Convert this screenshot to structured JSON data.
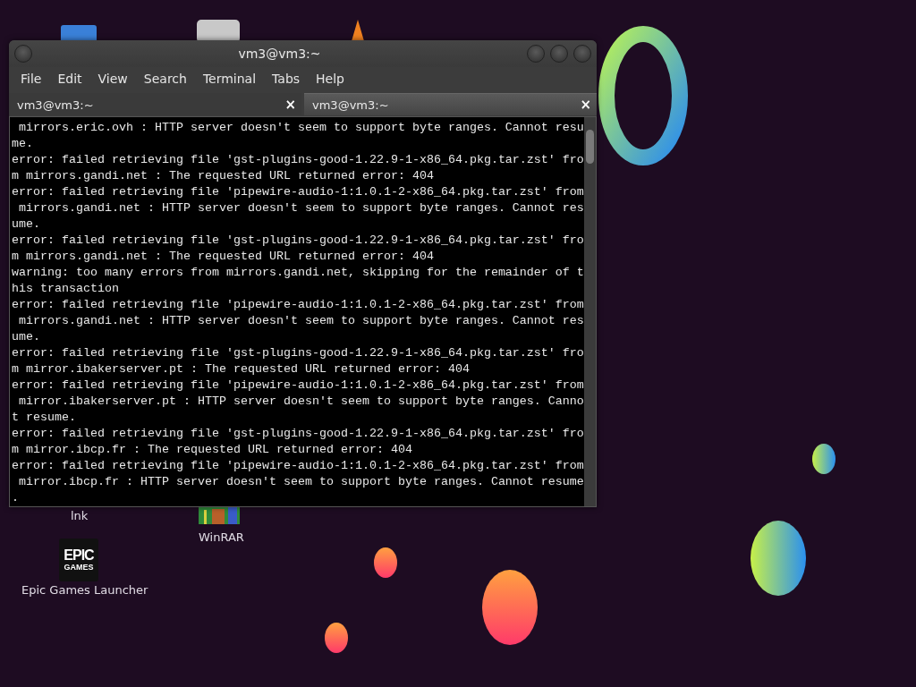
{
  "desktop": {
    "icons": [
      {
        "label": "lnk",
        "kind": "label"
      },
      {
        "label": "WinRAR",
        "kind": "winrar"
      },
      {
        "label": "Epic Games Launcher",
        "kind": "epic",
        "logo_top": "EPIC",
        "logo_bottom": "GAMES"
      }
    ]
  },
  "window": {
    "title": "vm3@vm3:~",
    "menu": [
      "File",
      "Edit",
      "View",
      "Search",
      "Terminal",
      "Tabs",
      "Help"
    ],
    "tabs": [
      {
        "label": "vm3@vm3:~",
        "selected": false
      },
      {
        "label": "vm3@vm3:~",
        "selected": true
      }
    ],
    "close_glyph": "×",
    "lines": [
      " mirrors.eric.ovh : HTTP server doesn't seem to support byte ranges. Cannot resu",
      "me.",
      "error: failed retrieving file 'gst-plugins-good-1.22.9-1-x86_64.pkg.tar.zst' fro",
      "m mirrors.gandi.net : The requested URL returned error: 404",
      "error: failed retrieving file 'pipewire-audio-1:1.0.1-2-x86_64.pkg.tar.zst' from",
      " mirrors.gandi.net : HTTP server doesn't seem to support byte ranges. Cannot res",
      "ume.",
      "error: failed retrieving file 'gst-plugins-good-1.22.9-1-x86_64.pkg.tar.zst' fro",
      "m mirrors.gandi.net : The requested URL returned error: 404",
      "warning: too many errors from mirrors.gandi.net, skipping for the remainder of t",
      "his transaction",
      "error: failed retrieving file 'pipewire-audio-1:1.0.1-2-x86_64.pkg.tar.zst' from",
      " mirrors.gandi.net : HTTP server doesn't seem to support byte ranges. Cannot res",
      "ume.",
      "error: failed retrieving file 'gst-plugins-good-1.22.9-1-x86_64.pkg.tar.zst' fro",
      "m mirror.ibakerserver.pt : The requested URL returned error: 404",
      "error: failed retrieving file 'pipewire-audio-1:1.0.1-2-x86_64.pkg.tar.zst' from",
      " mirror.ibakerserver.pt : HTTP server doesn't seem to support byte ranges. Canno",
      "t resume.",
      "error: failed retrieving file 'gst-plugins-good-1.22.9-1-x86_64.pkg.tar.zst' fro",
      "m mirror.ibcp.fr : The requested URL returned error: 404",
      "error: failed retrieving file 'pipewire-audio-1:1.0.1-2-x86_64.pkg.tar.zst' from",
      " mirror.ibcp.fr : HTTP server doesn't seem to support byte ranges. Cannot resume",
      "."
    ]
  }
}
